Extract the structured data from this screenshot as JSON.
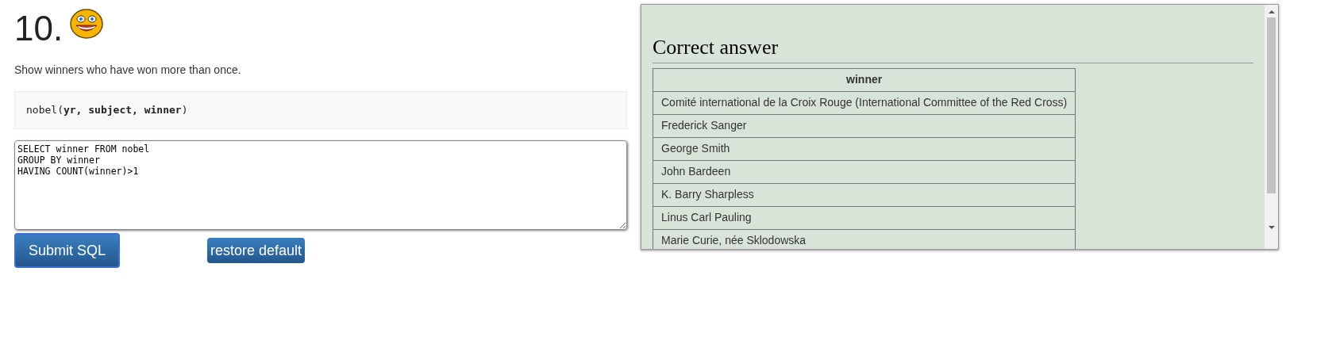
{
  "question": {
    "number": "10.",
    "prompt": "Show winners who have won more than once.",
    "schema": "nobel(**yr, subject, winner**)"
  },
  "editor": {
    "value": "SELECT winner FROM nobel\nGROUP BY winner\nHAVING COUNT(winner)>1"
  },
  "buttons": [
    {
      "label": "Submit SQL",
      "kind": "primary"
    },
    {
      "label": "restore default",
      "kind": "secondary"
    }
  ],
  "answer": {
    "title": "Correct answer",
    "columns": [
      "winner"
    ],
    "rows": [
      [
        "Comité international de la Croix Rouge (International Committee of the Red Cross)"
      ],
      [
        "Frederick Sanger"
      ],
      [
        "George Smith"
      ],
      [
        "John Bardeen"
      ],
      [
        "K. Barry Sharpless"
      ],
      [
        "Linus Carl Pauling"
      ],
      [
        "Marie Curie, née Sklodowska"
      ]
    ]
  }
}
